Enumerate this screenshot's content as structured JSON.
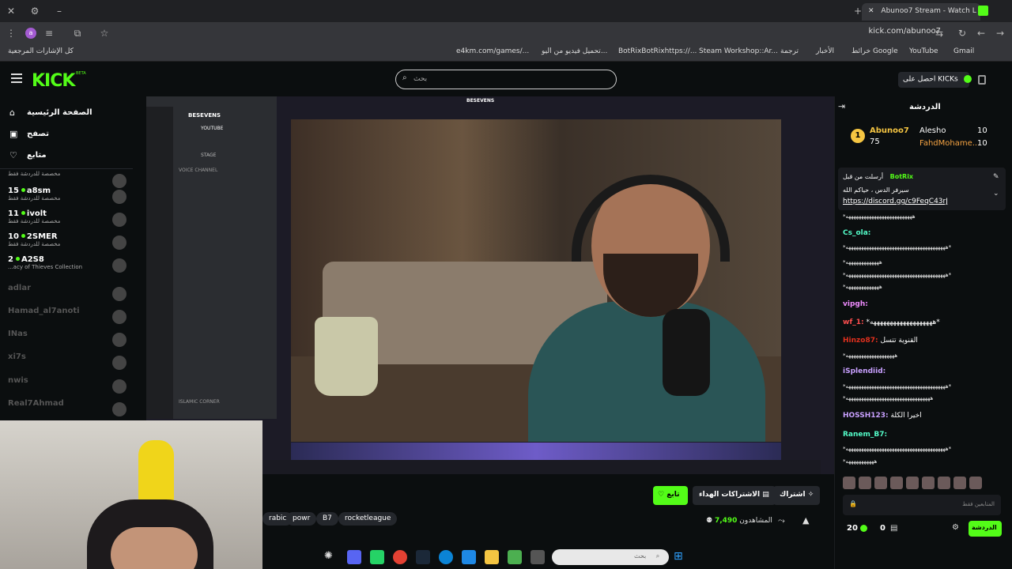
{
  "browser": {
    "tab_title": "Abunoo7 Stream - Watch L",
    "url": "kick.com/abunoo7",
    "bookmarks_label": "كل الإشارات المرجعية",
    "bookmarks": [
      "e4km.com/games/...",
      "تحميل فيديو من اليو...",
      "BotRixBotRixhttps://...",
      "Steam Workshop::Ar...",
      "ترجمة",
      "الأخبار",
      "خرائط Google",
      "YouTube",
      "Gmail"
    ]
  },
  "header": {
    "logo": "KICK",
    "logo_sup": "BETA",
    "search_placeholder": "بحث",
    "get_kicks": "احصل على KICKs"
  },
  "sidebar": {
    "nav": [
      "الصفحة الرئيسية",
      "تصفح",
      "متابع"
    ],
    "channels": [
      {
        "viewers": "",
        "name": "",
        "sub": "مخصصة للدردشة فقط",
        "dim": false
      },
      {
        "viewers": "15",
        "name": "a8sm",
        "sub": "مخصصة للدردشة فقط",
        "dim": false
      },
      {
        "viewers": "11",
        "name": "ivolt",
        "sub": "مخصصة للدردشة فقط",
        "dim": false
      },
      {
        "viewers": "10",
        "name": "2SMER",
        "sub": "مخصصة للدردشة فقط",
        "dim": false
      },
      {
        "viewers": "2",
        "name": "A2S8",
        "sub": "...acy of Thieves Collection",
        "dim": false
      },
      {
        "viewers": "",
        "name": "adlar",
        "sub": "",
        "dim": true
      },
      {
        "viewers": "",
        "name": "Hamad_al7anoti",
        "sub": "",
        "dim": true
      },
      {
        "viewers": "",
        "name": "INas",
        "sub": "",
        "dim": true
      },
      {
        "viewers": "",
        "name": "xi7s",
        "sub": "",
        "dim": true
      },
      {
        "viewers": "",
        "name": "nwis",
        "sub": "",
        "dim": true
      },
      {
        "viewers": "",
        "name": "Real7Ahmad",
        "sub": "",
        "dim": true
      }
    ]
  },
  "stream": {
    "title_overlay": "BESEVENS",
    "discord_server": "BESEVENS",
    "discord_channels": [
      "YOUTUBE",
      "STAGE",
      "VOICE CHANNEL",
      "ISLAMIC CORNER"
    ]
  },
  "below": {
    "tags": [
      "rabic",
      "powr",
      "B7",
      "rocketleague"
    ],
    "follow": "تابع",
    "free_subs": "الاشتراكات الهداء",
    "subscribe": "اشتراك",
    "viewers_label": "المشاهدون",
    "viewers_count": "7,490"
  },
  "taskbar": {
    "search_placeholder": "بحث"
  },
  "chat": {
    "title": "الدردشة",
    "gifters": [
      {
        "rank": "1",
        "name": "Abunoo7",
        "count": "75"
      },
      {
        "rank": "",
        "name": "Alesho",
        "count": "10"
      },
      {
        "rank": "",
        "name": "FahdMohame...",
        "count": "10"
      }
    ],
    "pinned_header": "أرسلت من قبل",
    "pinned_user": "BotRix",
    "pinned_text": "سيرفر الدس ، حياكم الله",
    "pinned_link": "https://discord.gg/c9FeqC43rJ",
    "messages": [
      {
        "user": "",
        "color": "#ffffff",
        "text": "*ههههههههههههههههههههههههههه"
      },
      {
        "user": "Cs_ola:",
        "color": "#53fcc8",
        "text": ""
      },
      {
        "user": "",
        "color": "#ffffff",
        "text": "*هههههههههههههههههههههههههههههههههههههههه*"
      },
      {
        "user": "",
        "color": "#ffffff",
        "text": "*هههههههههههههه"
      },
      {
        "user": "",
        "color": "#ffffff",
        "text": "*هههههههههههههههههههههههههههههههههههههههه*"
      },
      {
        "user": "",
        "color": "#ffffff",
        "text": "*هههههههههههههه"
      },
      {
        "user": "vipgh:",
        "color": "#f08cff",
        "text": ""
      },
      {
        "user": "wf_1:",
        "color": "#ff4f4f",
        "text": "*هههههههههههههههههههه*"
      },
      {
        "user": "Hinzo87:",
        "color": "#e0301e",
        "text": "القنوية تتسل"
      },
      {
        "user": "",
        "color": "#ffffff",
        "text": "*هههههههههههههههههههه"
      },
      {
        "user": "iSplendiid:",
        "color": "#c9a0ff",
        "text": ""
      },
      {
        "user": "",
        "color": "#ffffff",
        "text": "*هههههههههههههههههههههههههههههههههههههههه*"
      },
      {
        "user": "",
        "color": "#ffffff",
        "text": "*هههههههههههههههههههههههههههههههههه"
      },
      {
        "user": "HOSSH123:",
        "color": "#c9a0ff",
        "text": "اخيرا الكلة"
      },
      {
        "user": "Ranem_B7:",
        "color": "#53fcc8",
        "text": ""
      },
      {
        "user": "",
        "color": "#ffffff",
        "text": "*هههههههههههههههههههههههههههههههههههههههه*"
      },
      {
        "user": "",
        "color": "#ffffff",
        "text": "*هههههههههههه"
      }
    ],
    "input_placeholder": "المتابعين فقط",
    "send": "الدردشة",
    "kicks_count": "20",
    "points_count": "0"
  }
}
